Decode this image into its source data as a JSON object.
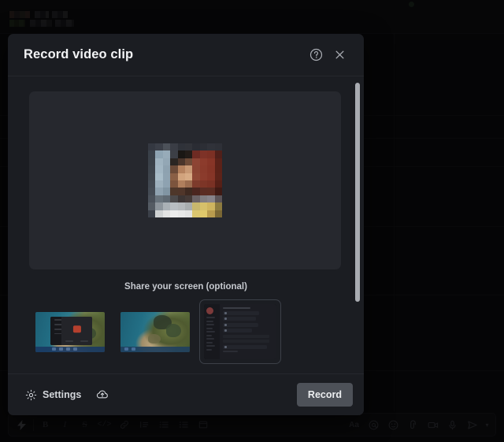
{
  "dialog": {
    "title": "Record video clip",
    "help_icon": "question-circle-icon",
    "close_icon": "close-icon",
    "preview": {
      "label": "camera-preview",
      "state": "pixelated-blurred-webcam"
    },
    "share_section_label": "Share your screen (optional)",
    "screen_options": [
      {
        "name": "screen-thumbnail-1",
        "kind": "desktop-with-window",
        "selected": false
      },
      {
        "name": "screen-thumbnail-2",
        "kind": "desktop-wallpaper",
        "selected": false
      },
      {
        "name": "screen-thumbnail-3",
        "kind": "application-window",
        "selected": true
      }
    ],
    "footer": {
      "settings_label": "Settings",
      "settings_icon": "gear-icon",
      "upload_icon": "cloud-upload-icon",
      "record_label": "Record"
    },
    "scrollbar": {
      "orientation": "vertical",
      "position": "top"
    }
  },
  "background": {
    "redacted_name": "",
    "composer": {
      "left_tools": [
        {
          "name": "lightning-icon",
          "glyph": "⚡",
          "active": true
        },
        {
          "name": "bold-icon",
          "glyph": "B",
          "active": false
        },
        {
          "name": "italic-icon",
          "glyph": "I",
          "active": false
        },
        {
          "name": "strikethrough-icon",
          "glyph": "S",
          "active": false
        },
        {
          "name": "code-icon",
          "glyph": "‹›",
          "active": false
        },
        {
          "name": "link-icon",
          "glyph": "🔗",
          "active": false
        },
        {
          "name": "blockquote-icon",
          "glyph": "❝",
          "active": false
        },
        {
          "name": "ordered-list-icon",
          "glyph": "≔",
          "active": false
        },
        {
          "name": "bulleted-list-icon",
          "glyph": "≡",
          "active": false
        },
        {
          "name": "code-block-icon",
          "glyph": "▣",
          "active": false
        }
      ],
      "right_tools": [
        {
          "name": "text-format-icon",
          "glyph": "Aa"
        },
        {
          "name": "mention-icon",
          "glyph": "@"
        },
        {
          "name": "emoji-icon",
          "glyph": "☺"
        },
        {
          "name": "attachment-icon",
          "glyph": "📎"
        },
        {
          "name": "video-clip-icon",
          "glyph": "▭"
        },
        {
          "name": "microphone-icon",
          "glyph": "🎤"
        },
        {
          "name": "send-icon",
          "glyph": "➤"
        },
        {
          "name": "send-options-chevron-icon",
          "glyph": "▾"
        }
      ]
    }
  },
  "colors": {
    "dialog_bg": "#1b1d22",
    "preview_bg": "#26282e",
    "record_button": "#4d5158",
    "scrollbar": "#a9acb2",
    "text_primary": "#f2f3f5",
    "text_secondary": "#c6c9cf"
  }
}
